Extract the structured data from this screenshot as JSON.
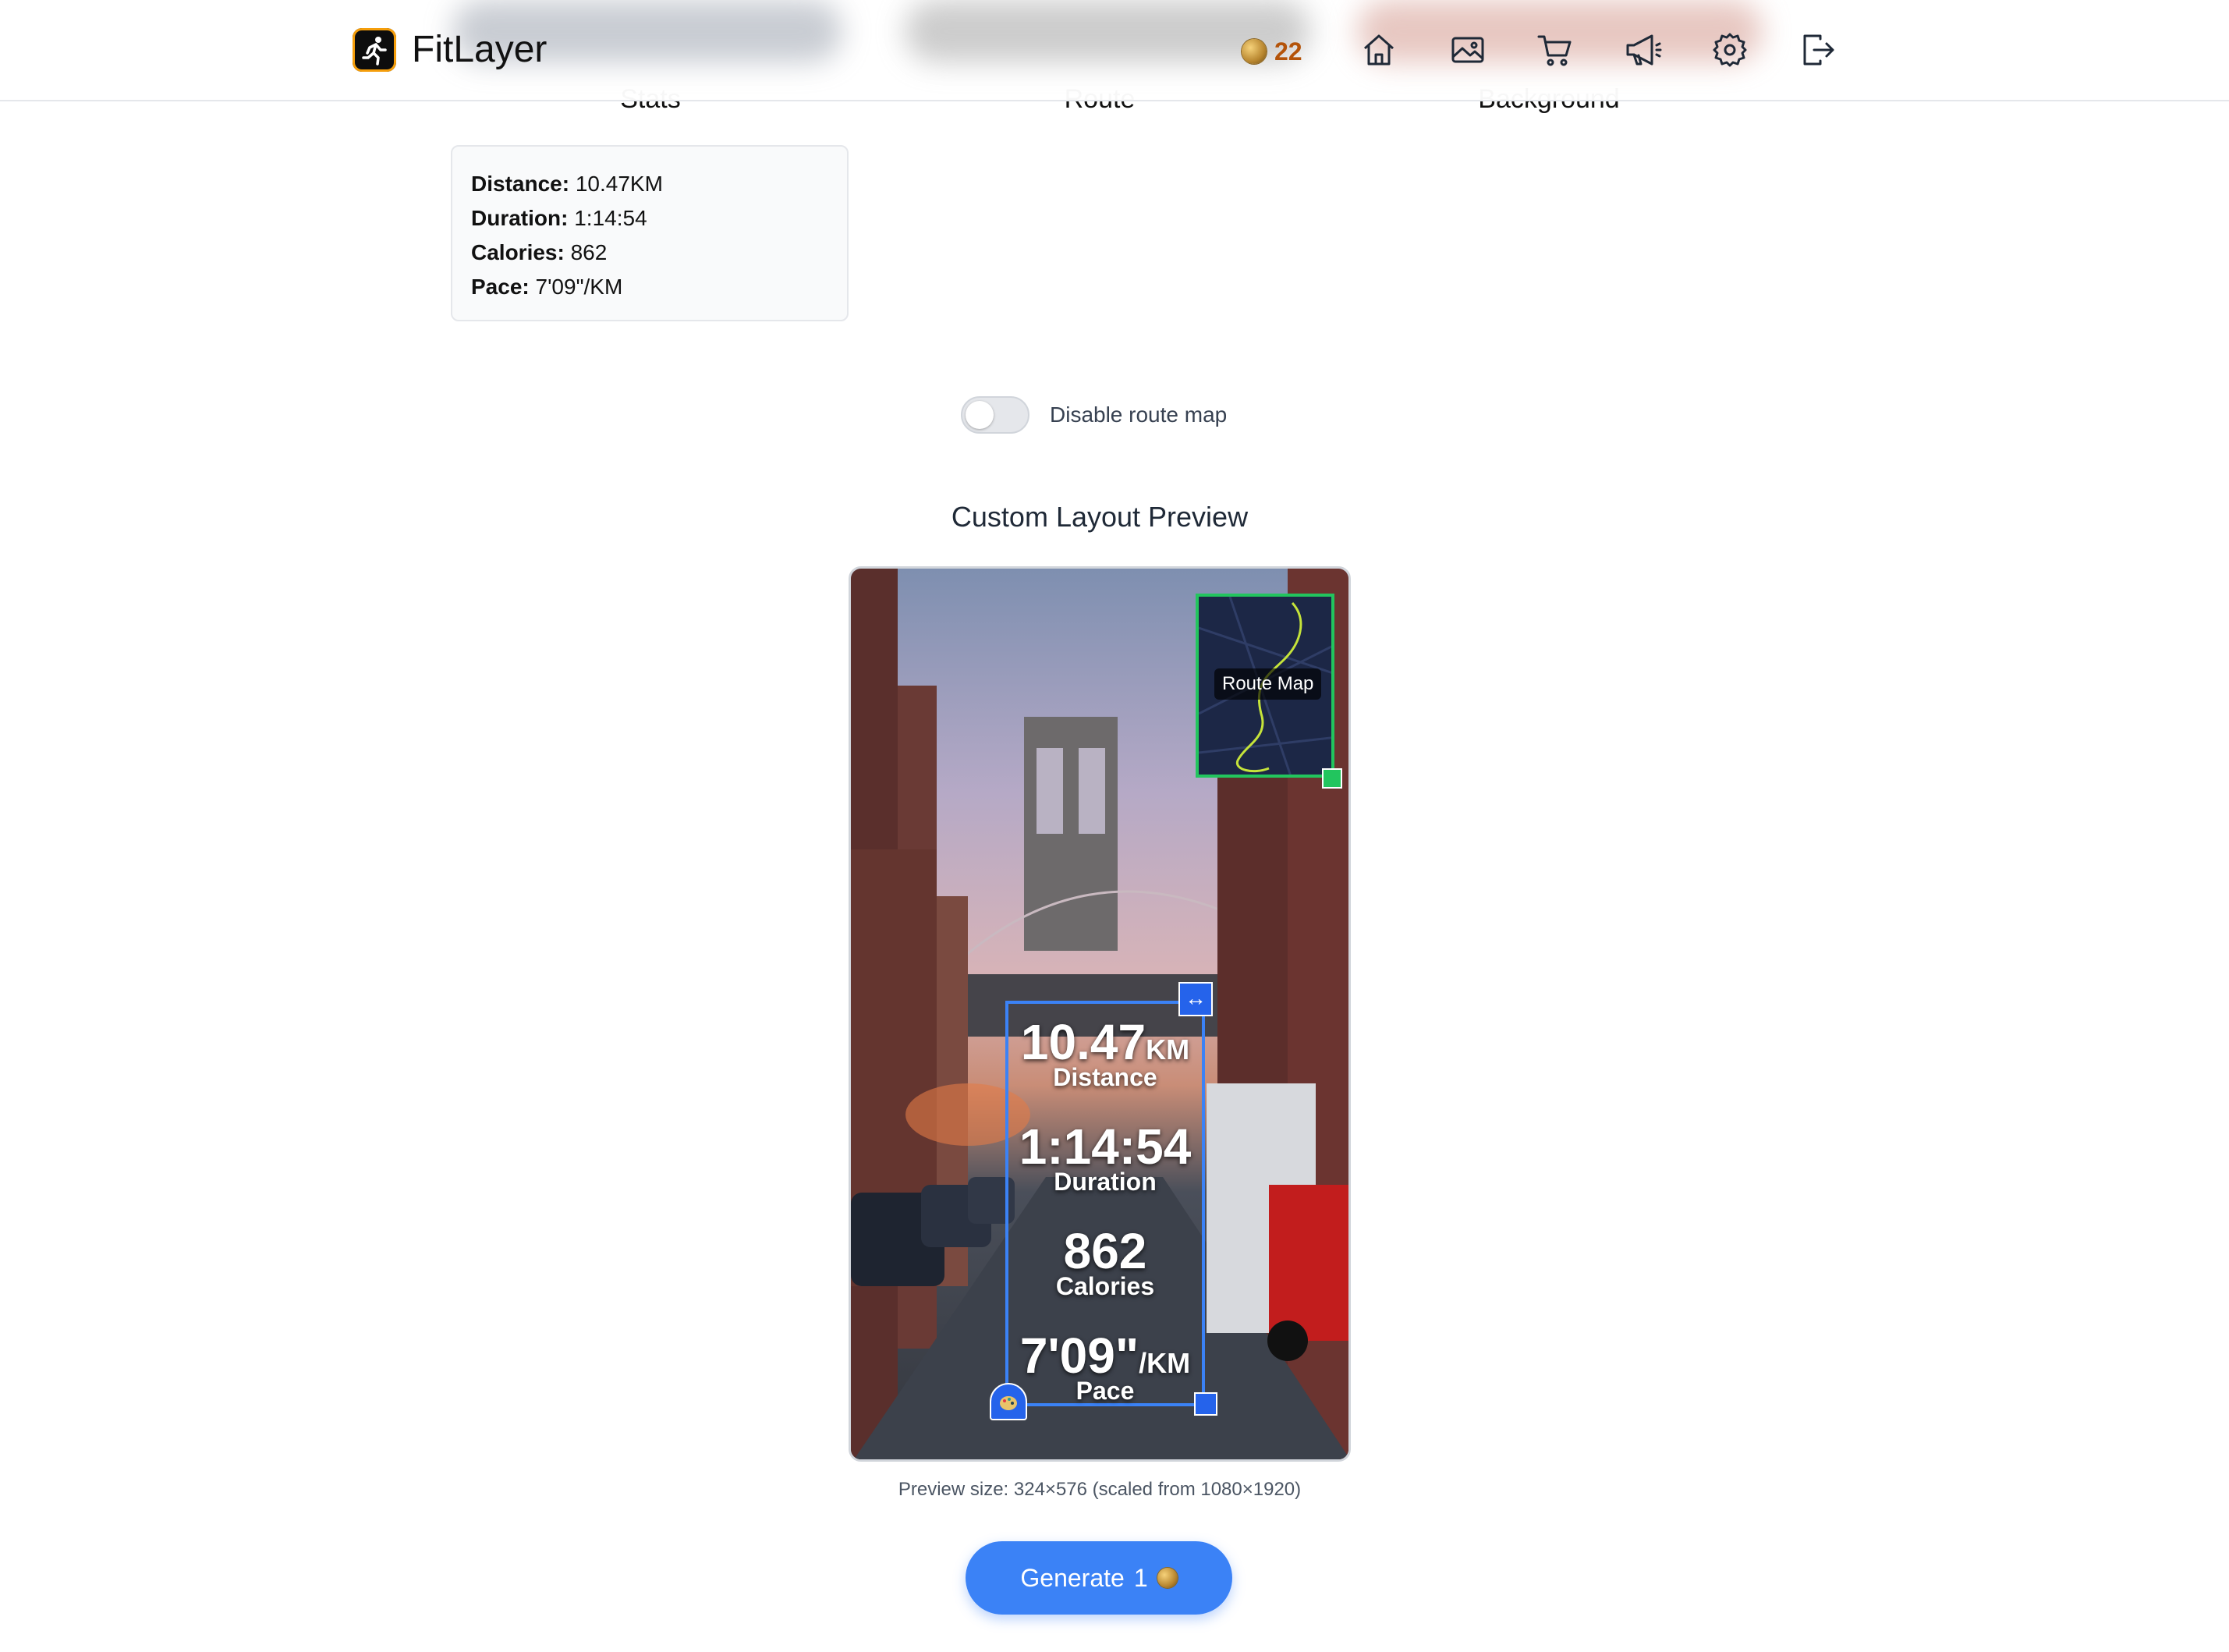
{
  "header": {
    "app_name": "FitLayer",
    "coin_balance": "22",
    "nav_icons": [
      "home-icon",
      "gallery-icon",
      "cart-icon",
      "megaphone-icon",
      "settings-icon",
      "logout-icon"
    ]
  },
  "columns": {
    "stats_title": "Stats",
    "route_title": "Route",
    "background_title": "Background"
  },
  "stats": {
    "distance_label": "Distance:",
    "distance_value": "10.47KM",
    "duration_label": "Duration:",
    "duration_value": "1:14:54",
    "calories_label": "Calories:",
    "calories_value": "862",
    "pace_label": "Pace:",
    "pace_value": "7'09\"/KM"
  },
  "toggle": {
    "label": "Disable route map",
    "checked": false
  },
  "preview": {
    "title": "Custom Layout Preview",
    "route_map_label": "Route Map",
    "overlay": {
      "distance_value": "10.47",
      "distance_unit": "KM",
      "distance_label": "Distance",
      "duration_value": "1:14:54",
      "duration_label": "Duration",
      "calories_value": "862",
      "calories_label": "Calories",
      "pace_value": "7'09\"",
      "pace_unit": "/KM",
      "pace_label": "Pace"
    },
    "size_note": "Preview size: 324×576 (scaled from 1080×1920)"
  },
  "generate": {
    "label": "Generate",
    "cost": "1"
  },
  "colors": {
    "accent": "#3b82f6",
    "route_frame": "#22c55e",
    "coin_text": "#b45309"
  }
}
